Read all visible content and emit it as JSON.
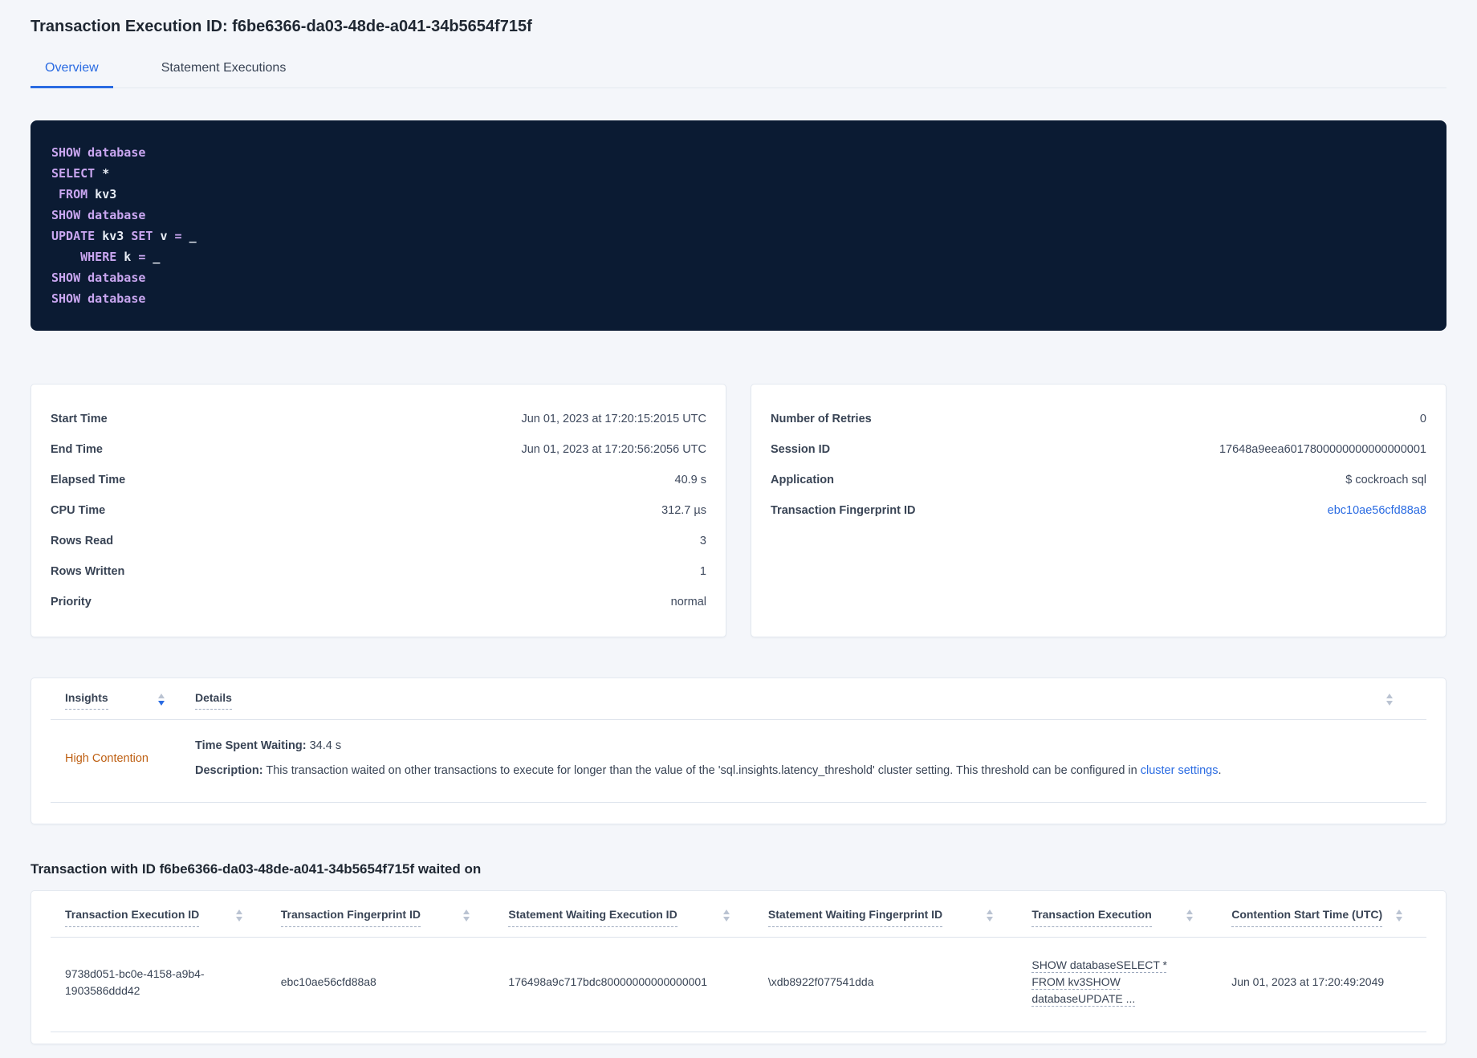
{
  "page": {
    "title": "Transaction Execution ID: f6be6366-da03-48de-a041-34b5654f715f"
  },
  "tabs": [
    {
      "label": "Overview",
      "active": true
    },
    {
      "label": "Statement Executions",
      "active": false
    }
  ],
  "sql_box": {
    "lines": [
      [
        {
          "k": "kw",
          "t": "SHOW"
        },
        {
          "k": "pl",
          "t": " "
        },
        {
          "k": "kw",
          "t": "database"
        }
      ],
      [
        {
          "k": "kw",
          "t": "SELECT"
        },
        {
          "k": "pl",
          "t": " *"
        }
      ],
      [
        {
          "k": "pl",
          "t": " "
        },
        {
          "k": "kw",
          "t": "FROM"
        },
        {
          "k": "pl",
          "t": " kv3"
        }
      ],
      [
        {
          "k": "kw",
          "t": "SHOW"
        },
        {
          "k": "pl",
          "t": " "
        },
        {
          "k": "kw",
          "t": "database"
        }
      ],
      [
        {
          "k": "kw",
          "t": "UPDATE"
        },
        {
          "k": "pl",
          "t": " kv3 "
        },
        {
          "k": "kw",
          "t": "SET"
        },
        {
          "k": "pl",
          "t": " v "
        },
        {
          "k": "kw",
          "t": "="
        },
        {
          "k": "pl",
          "t": " _"
        }
      ],
      [
        {
          "k": "pl",
          "t": "    "
        },
        {
          "k": "kw",
          "t": "WHERE"
        },
        {
          "k": "pl",
          "t": " k "
        },
        {
          "k": "kw",
          "t": "="
        },
        {
          "k": "pl",
          "t": " _"
        }
      ],
      [
        {
          "k": "kw",
          "t": "SHOW"
        },
        {
          "k": "pl",
          "t": " "
        },
        {
          "k": "kw",
          "t": "database"
        }
      ],
      [
        {
          "k": "kw",
          "t": "SHOW"
        },
        {
          "k": "pl",
          "t": " "
        },
        {
          "k": "kw",
          "t": "database"
        }
      ]
    ]
  },
  "left_card": {
    "rows": [
      {
        "label": "Start Time",
        "value": "Jun 01, 2023 at 17:20:15:2015 UTC"
      },
      {
        "label": "End Time",
        "value": "Jun 01, 2023 at 17:20:56:2056 UTC"
      },
      {
        "label": "Elapsed Time",
        "value": "40.9 s"
      },
      {
        "label": "CPU Time",
        "value": "312.7 µs"
      },
      {
        "label": "Rows Read",
        "value": "3"
      },
      {
        "label": "Rows Written",
        "value": "1"
      },
      {
        "label": "Priority",
        "value": "normal"
      }
    ]
  },
  "right_card": {
    "rows": [
      {
        "label": "Number of Retries",
        "value": "0"
      },
      {
        "label": "Session ID",
        "value": "17648a9eea6017800000000000000001"
      },
      {
        "label": "Application",
        "value": "$ cockroach sql"
      }
    ],
    "fingerprint_row": {
      "label": "Transaction Fingerprint ID",
      "value": "ebc10ae56cfd88a8"
    }
  },
  "insights_table": {
    "columns": {
      "insights": "Insights",
      "details": "Details"
    },
    "row": {
      "insight": "High Contention",
      "waiting_label": "Time Spent Waiting:",
      "waiting_value": " 34.4 s",
      "description_label": "Description:",
      "description_text": " This transaction waited on other transactions to execute for longer than the value of the 'sql.insights.latency_threshold' cluster setting. This threshold can be configured in ",
      "description_link": "cluster settings",
      "description_suffix": "."
    }
  },
  "waited_on": {
    "title": "Transaction with ID f6be6366-da03-48de-a041-34b5654f715f waited on",
    "columns": {
      "c1": "Transaction Execution ID",
      "c2": "Transaction Fingerprint ID",
      "c3": "Statement Waiting Execution ID",
      "c4": "Statement Waiting Fingerprint ID",
      "c5": "Transaction Execution",
      "c6": "Contention Start Time (UTC)"
    },
    "row": {
      "transaction_execution_id": "9738d051-bc0e-4158-a9b4-1903586ddd42",
      "transaction_fingerprint_id": "ebc10ae56cfd88a8",
      "statement_waiting_execution_id": "176498a9c717bdc80000000000000001",
      "statement_waiting_fingerprint_id": "\\xdb8922f077541dda",
      "transaction_execution": "SHOW databaseSELECT * FROM kv3SHOW databaseUPDATE ...",
      "contention_start_time": "Jun 01, 2023 at 17:20:49:2049"
    }
  },
  "colors": {
    "accent_blue": "#2A6BE2",
    "insight_orange": "#BE5F12",
    "code_background": "#0B1B33",
    "code_keyword": "#C9A6F0",
    "code_plain": "#E8EDF5",
    "page_background": "#F4F6FA"
  }
}
